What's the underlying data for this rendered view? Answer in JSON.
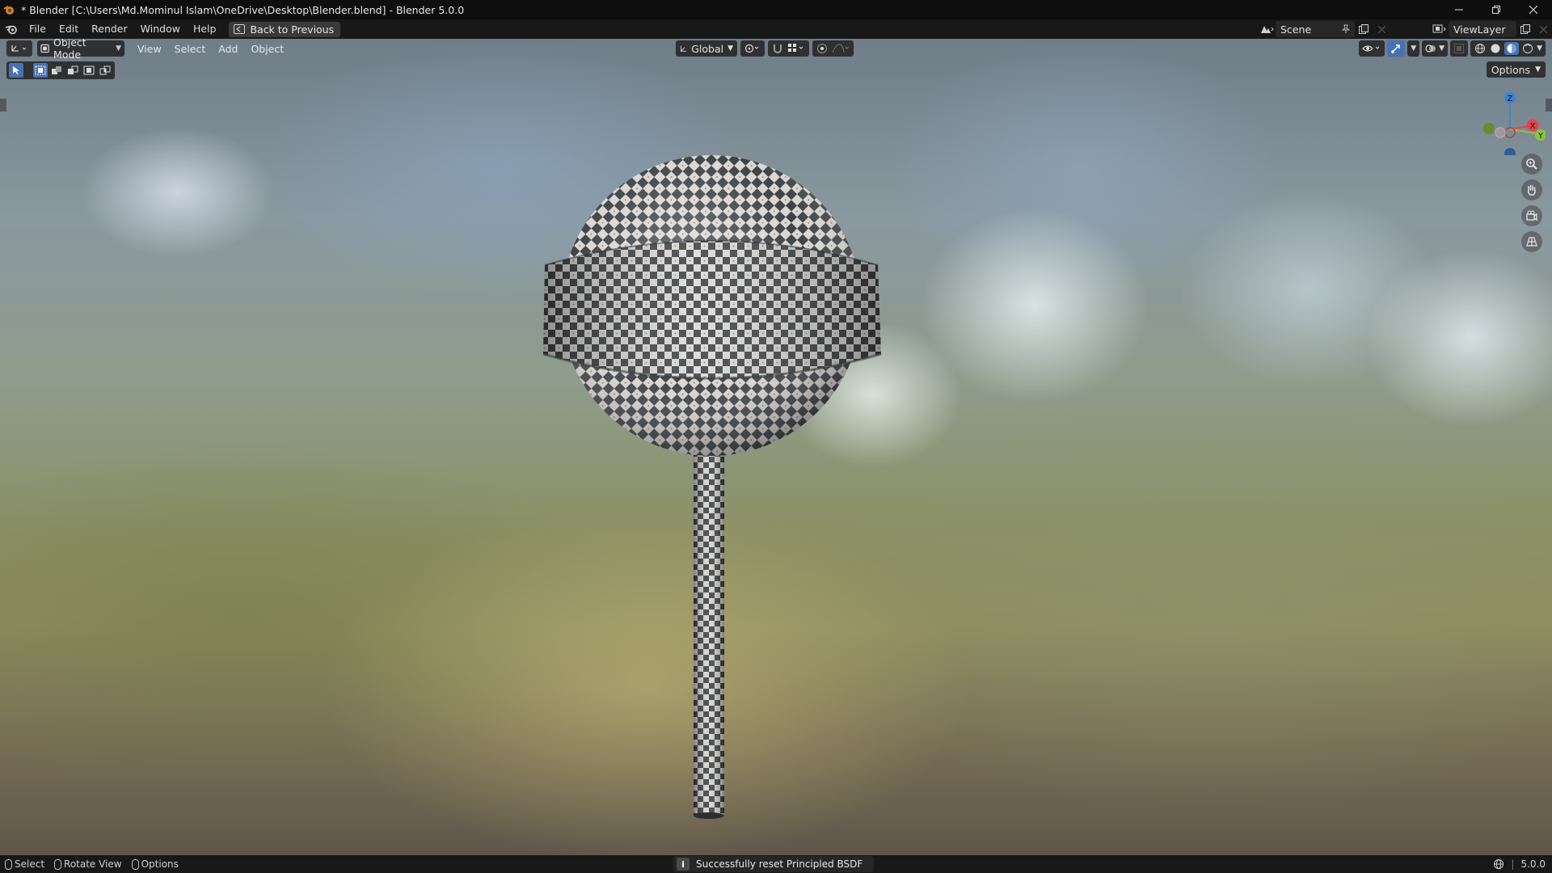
{
  "window": {
    "title": "* Blender [C:\\Users\\Md.Mominul Islam\\OneDrive\\Desktop\\Blender.blend] - Blender 5.0.0",
    "controls": [
      "minimize",
      "restore",
      "close"
    ]
  },
  "menubar": {
    "items": [
      "File",
      "Edit",
      "Render",
      "Window",
      "Help"
    ],
    "back_button": "Back to Previous",
    "scene": "Scene",
    "view_layer": "ViewLayer"
  },
  "viewport_header": {
    "mode": "Object Mode",
    "menus": [
      "View",
      "Select",
      "Add",
      "Object"
    ],
    "transform_orientation": "Global",
    "options_label": "Options",
    "shading_active": "material-preview"
  },
  "gizmo": {
    "axes": [
      "X",
      "Y",
      "Z"
    ],
    "colors": {
      "x": "#e8404f",
      "y": "#8bc43a",
      "z": "#3b84d8"
    }
  },
  "statusbar": {
    "hints": [
      "Select",
      "Rotate View",
      "Options"
    ],
    "report": "Successfully reset Principled BSDF",
    "version": "5.0.0"
  },
  "theme": {
    "accent": "#4772b3",
    "titlebar": "#0e0e0e",
    "header": "#181818"
  }
}
